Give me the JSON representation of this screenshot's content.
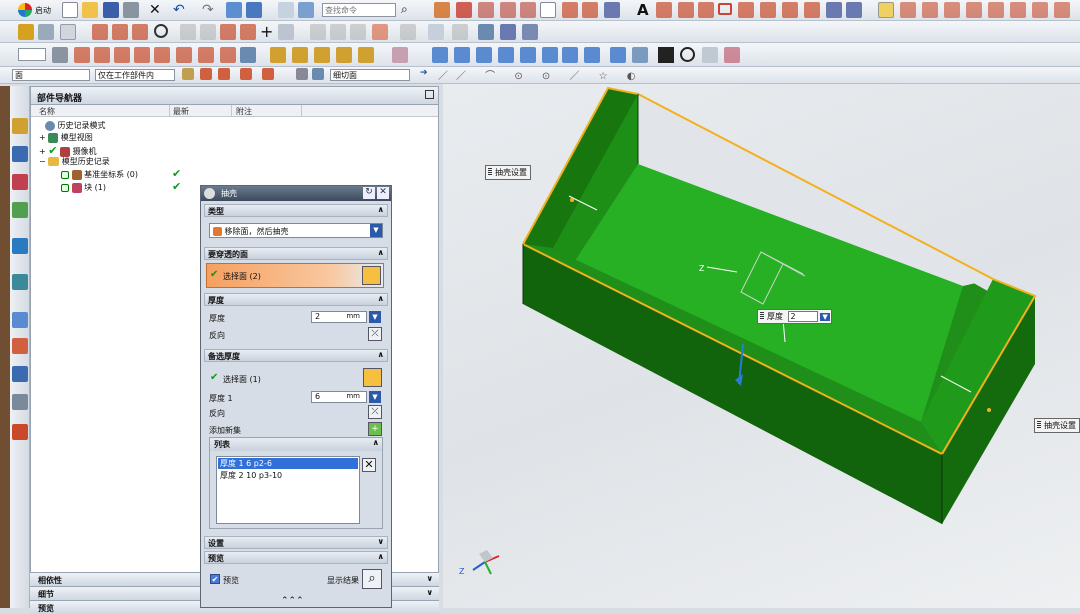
{
  "app": {
    "menu_label": "启动",
    "search_placeholder": "查找命令"
  },
  "toolbar3": {
    "filter_label": "面",
    "scope_label": "仅在工作部件内",
    "view_label": "细切面"
  },
  "navigator": {
    "title": "部件导航器",
    "col_name": "名称",
    "col_latest": "最新",
    "col_note": "附注",
    "rows": [
      {
        "label": "历史记录模式"
      },
      {
        "label": "模型视图"
      },
      {
        "label": "摄像机"
      },
      {
        "label": "模型历史记录"
      },
      {
        "label": "基准坐标系 (0)"
      },
      {
        "label": "块 (1)"
      }
    ],
    "sections": [
      "相依性",
      "细节",
      "预览"
    ]
  },
  "dialog": {
    "title": "抽壳",
    "sec_type": "类型",
    "type_value": "移除面，然后抽壳",
    "sec_faces": "要穿透的面",
    "select_faces": "选择面 (2)",
    "sec_thickness": "厚度",
    "thickness_label": "厚度",
    "thickness_value": "2",
    "unit": "mm",
    "reverse_label": "反向",
    "sec_alt": "备选厚度",
    "alt_select": "选择面 (1)",
    "alt_thickness_label": "厚度 1",
    "alt_thickness_value": "6",
    "alt_unit": "mm",
    "alt_reverse_label": "反向",
    "add_set_label": "添加新集",
    "list_title": "列表",
    "list_items": [
      "厚度 1   6    p2-6",
      "厚度 2   10   p3-10"
    ],
    "sec_settings": "设置",
    "sec_preview": "预览",
    "preview_label": "预览",
    "show_result_label": "显示结果"
  },
  "viewport": {
    "tag_top": "抽壳设置",
    "tag_right": "抽壳设置",
    "thickness_tag_label": "厚度",
    "thickness_tag_value": "2",
    "axis_label": "Z"
  },
  "colors": {
    "solid_top": "#27c423",
    "solid_side": "#136b0e",
    "edge": "#f2b11c",
    "highlight": "#f08a3a"
  }
}
